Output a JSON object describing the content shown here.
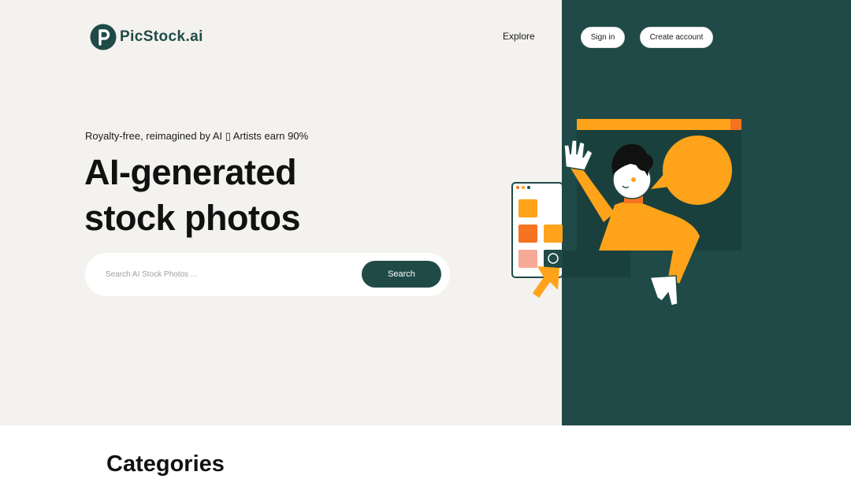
{
  "brand": {
    "name": "PicStock.ai"
  },
  "nav": {
    "explore_label": "Explore",
    "signin_label": "Sign in",
    "create_account_label": "Create account"
  },
  "hero": {
    "tagline": "Royalty-free, reimagined by AI ▯ Artists earn 90%",
    "headline_line1": "AI-generated",
    "headline_line2": "stock photos"
  },
  "search": {
    "placeholder": "Search AI Stock Photos ...",
    "button_label": "Search"
  },
  "sections": {
    "categories_title": "Categories"
  },
  "colors": {
    "brand_dark": "#1f4a47",
    "hero_bg": "#f4f2ee",
    "accent_orange": "#ffa31a",
    "accent_red_orange": "#f77320",
    "accent_peach": "#f7a998"
  },
  "icons": {
    "logo": "p-letter-logo-icon",
    "illustration": "person-waving-with-speech-bubble"
  }
}
